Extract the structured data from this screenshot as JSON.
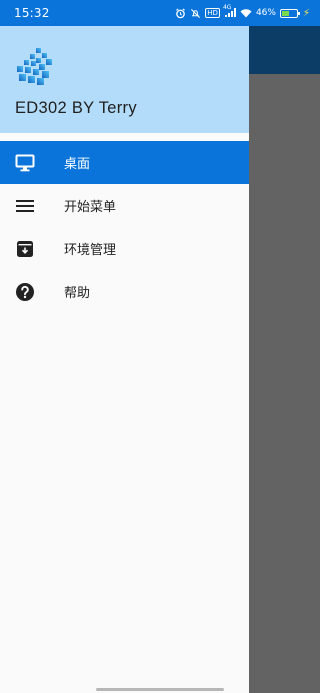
{
  "status_bar": {
    "time": "15:32",
    "hd_badge": "HD",
    "signal_badge": "4G",
    "battery_percent": "46%",
    "battery_level": 0.46,
    "icons": [
      "alarm-icon",
      "mute-icon",
      "hd-icon",
      "signal-icon",
      "wifi-icon",
      "battery-icon",
      "charging-icon"
    ]
  },
  "drawer": {
    "app_name": "ED302 BY Terry",
    "logo": "windows-grid-logo",
    "items": [
      {
        "label": "桌面",
        "icon": "monitor-icon",
        "active": true
      },
      {
        "label": "开始菜单",
        "icon": "menu-lines-icon",
        "active": false
      },
      {
        "label": "环境管理",
        "icon": "archive-icon",
        "active": false
      },
      {
        "label": "帮助",
        "icon": "help-icon",
        "active": false
      }
    ]
  },
  "colors": {
    "accent": "#0a74da",
    "header_bg": "#b3dcfa",
    "drawer_bg": "#fafafa",
    "app_toolbar": "#0b3d66",
    "scrim": "#646464"
  }
}
